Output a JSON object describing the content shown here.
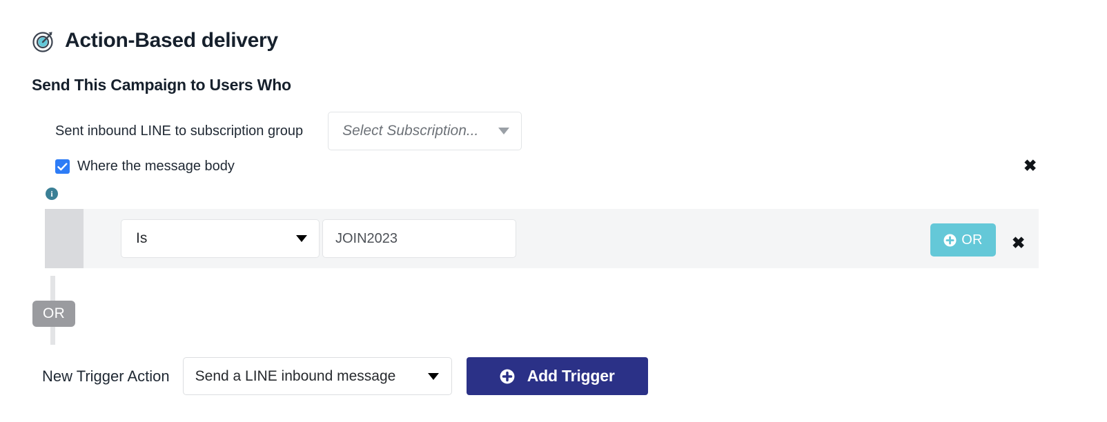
{
  "header": {
    "icon": "target-icon",
    "title": "Action-Based delivery"
  },
  "section": {
    "title": "Send This Campaign to Users Who"
  },
  "trigger": {
    "label": "Sent inbound LINE to subscription group",
    "subscription_placeholder": "Select Subscription...",
    "dropdown_icon": "chevron-down-icon"
  },
  "condition_group": {
    "checkbox_label": "Where the message body",
    "checkbox_checked": true,
    "info_icon_glyph": "i",
    "remove_label": "✖",
    "rows": [
      {
        "operator": "Is",
        "value": "JOIN2023",
        "or_button_label": "OR",
        "or_button_icon": "plus-circle-icon",
        "remove_label": "✖"
      }
    ],
    "connector_badge": "OR"
  },
  "footer": {
    "new_trigger_label": "New Trigger Action",
    "action_value": "Send a LINE inbound message",
    "action_dropdown_icon": "chevron-down-icon",
    "add_trigger_label": "Add Trigger",
    "add_trigger_icon": "plus-circle-icon"
  },
  "colors": {
    "accent_teal": "#64c8d8",
    "primary_navy": "#2b3187",
    "checkbox_blue": "#2e7cf6",
    "info_teal": "#3a7f95",
    "row_bg": "#f4f5f6",
    "handle_gray": "#d9dadd",
    "badge_gray": "#9a9b9f"
  }
}
